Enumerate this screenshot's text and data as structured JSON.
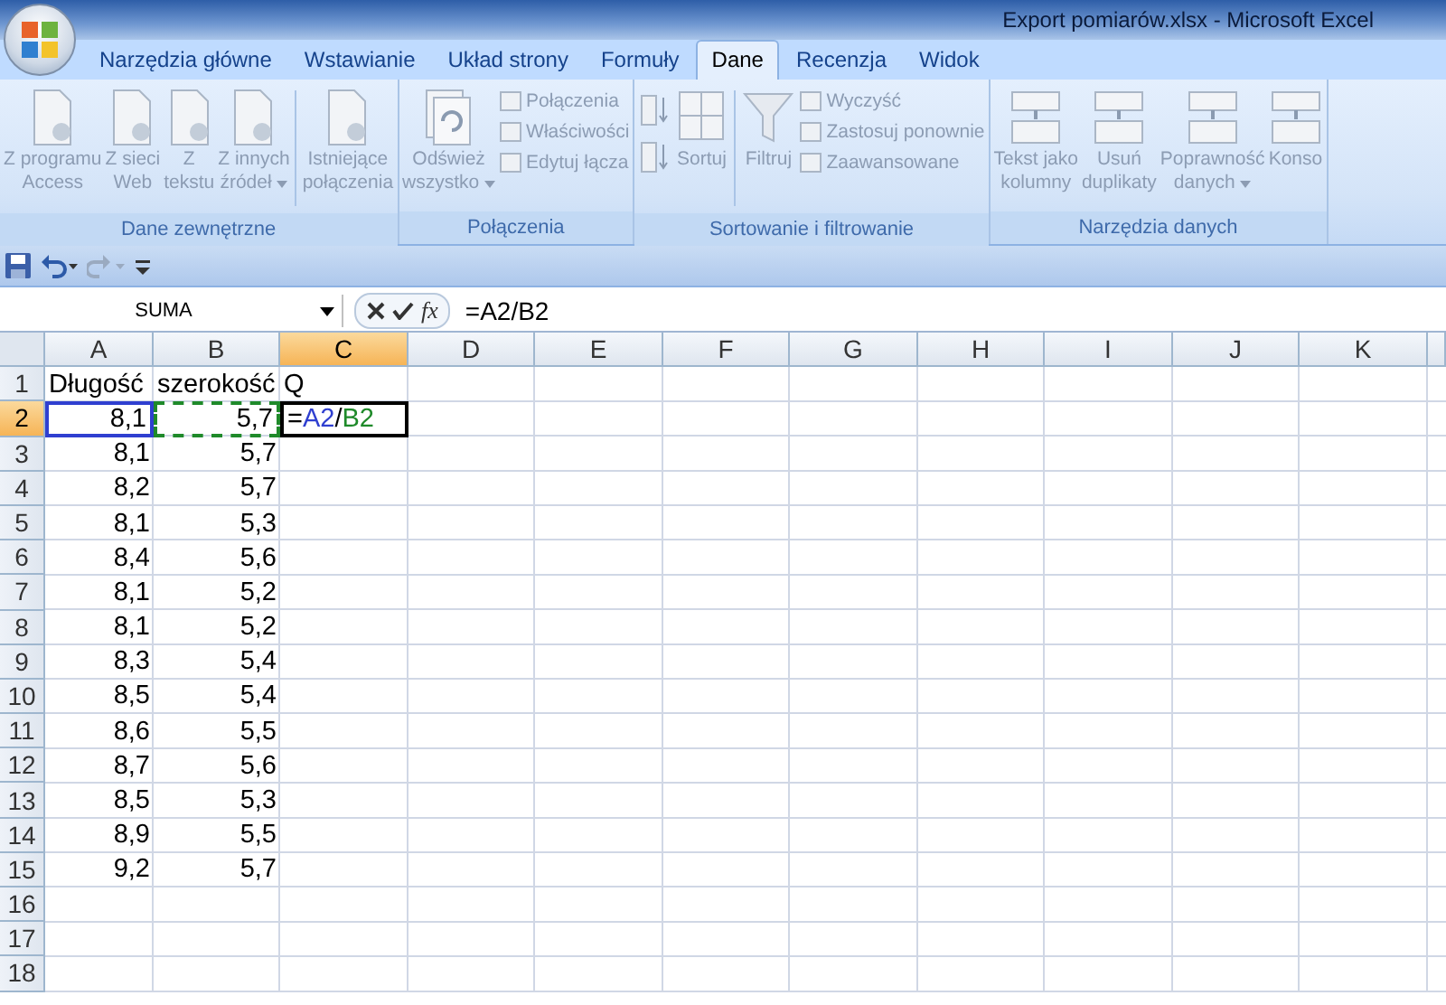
{
  "window": {
    "title": "Export pomiarów.xlsx - Microsoft Excel"
  },
  "tabs": [
    {
      "label": "Narzędzia główne",
      "selected": false
    },
    {
      "label": "Wstawianie",
      "selected": false
    },
    {
      "label": "Układ strony",
      "selected": false
    },
    {
      "label": "Formuły",
      "selected": false
    },
    {
      "label": "Dane",
      "selected": true
    },
    {
      "label": "Recenzja",
      "selected": false
    },
    {
      "label": "Widok",
      "selected": false
    }
  ],
  "ribbon": {
    "disabled": true,
    "groups": [
      {
        "label": "Dane zewnętrzne",
        "items": [
          {
            "kind": "large",
            "lines": [
              "Z programu",
              "Access"
            ],
            "dropdown": false
          },
          {
            "kind": "large",
            "lines": [
              "Z sieci",
              "Web"
            ],
            "dropdown": false
          },
          {
            "kind": "large",
            "lines": [
              "Z",
              "tekstu"
            ],
            "dropdown": false
          },
          {
            "kind": "large",
            "lines": [
              "Z innych",
              "źródeł"
            ],
            "dropdown": true
          },
          {
            "kind": "separator"
          },
          {
            "kind": "large",
            "lines": [
              "Istniejące",
              "połączenia"
            ],
            "dropdown": false
          }
        ]
      },
      {
        "label": "Połączenia",
        "items": [
          {
            "kind": "large",
            "lines": [
              "Odśwież",
              "wszystko"
            ],
            "dropdown": true
          },
          {
            "kind": "stack",
            "entries": [
              "Połączenia",
              "Właściwości",
              "Edytuj łącza"
            ]
          }
        ]
      },
      {
        "label": "Sortowanie i filtrowanie",
        "items": [
          {
            "kind": "sortpair"
          },
          {
            "kind": "large",
            "lines": [
              "Sortuj"
            ],
            "dropdown": false
          },
          {
            "kind": "separator"
          },
          {
            "kind": "large",
            "lines": [
              "Filtruj"
            ],
            "dropdown": false
          },
          {
            "kind": "stack",
            "entries": [
              "Wyczyść",
              "Zastosuj ponownie",
              "Zaawansowane"
            ]
          }
        ]
      },
      {
        "label": "Narzędzia danych",
        "items": [
          {
            "kind": "large",
            "lines": [
              "Tekst jako",
              "kolumny"
            ],
            "dropdown": false
          },
          {
            "kind": "large",
            "lines": [
              "Usuń",
              "duplikaty"
            ],
            "dropdown": false
          },
          {
            "kind": "large",
            "lines": [
              "Poprawność",
              "danych"
            ],
            "dropdown": true
          },
          {
            "kind": "large",
            "lines": [
              "Konso"
            ],
            "dropdown": false
          }
        ]
      }
    ]
  },
  "formula_bar": {
    "name_box": "SUMA",
    "function_label": "fx",
    "formula": "=A2/B2"
  },
  "columns": [
    {
      "label": "A",
      "selected": false
    },
    {
      "label": "B",
      "selected": false
    },
    {
      "label": "C",
      "selected": true
    },
    {
      "label": "D",
      "selected": false
    },
    {
      "label": "E",
      "selected": false
    },
    {
      "label": "F",
      "selected": false
    },
    {
      "label": "G",
      "selected": false
    },
    {
      "label": "H",
      "selected": false
    },
    {
      "label": "I",
      "selected": false
    },
    {
      "label": "J",
      "selected": false
    },
    {
      "label": "K",
      "selected": false
    }
  ],
  "rows": [
    {
      "number": "1",
      "selected": false,
      "cells": [
        "Długość",
        "szerokość",
        "Q"
      ]
    },
    {
      "number": "2",
      "selected": true,
      "cells": [
        {
          "kind": "reference",
          "text": "8,1",
          "color": "#2f3fd0"
        },
        {
          "kind": "marquee",
          "text": "5,7",
          "color": "#1f8a2a"
        },
        {
          "kind": "editing",
          "parts": [
            {
              "text": "=",
              "color": "#000000"
            },
            {
              "text": "A2",
              "color": "#2f3fd0"
            },
            {
              "text": "/",
              "color": "#000000"
            },
            {
              "text": "B2",
              "color": "#1f8a2a"
            }
          ]
        }
      ]
    },
    {
      "number": "3",
      "selected": false,
      "cells": [
        "8,1",
        "5,7"
      ]
    },
    {
      "number": "4",
      "selected": false,
      "cells": [
        "8,2",
        "5,7"
      ]
    },
    {
      "number": "5",
      "selected": false,
      "cells": [
        "8,1",
        "5,3"
      ]
    },
    {
      "number": "6",
      "selected": false,
      "cells": [
        "8,4",
        "5,6"
      ]
    },
    {
      "number": "7",
      "selected": false,
      "cells": [
        "8,1",
        "5,2"
      ]
    },
    {
      "number": "8",
      "selected": false,
      "cells": [
        "8,1",
        "5,2"
      ]
    },
    {
      "number": "9",
      "selected": false,
      "cells": [
        "8,3",
        "5,4"
      ]
    },
    {
      "number": "10",
      "selected": false,
      "cells": [
        "8,5",
        "5,4"
      ]
    },
    {
      "number": "11",
      "selected": false,
      "cells": [
        "8,6",
        "5,5"
      ]
    },
    {
      "number": "12",
      "selected": false,
      "cells": [
        "8,7",
        "5,6"
      ]
    },
    {
      "number": "13",
      "selected": false,
      "cells": [
        "8,5",
        "5,3"
      ]
    },
    {
      "number": "14",
      "selected": false,
      "cells": [
        "8,9",
        "5,5"
      ]
    },
    {
      "number": "15",
      "selected": false,
      "cells": [
        "9,2",
        "5,7"
      ]
    },
    {
      "number": "16",
      "selected": false,
      "cells": []
    },
    {
      "number": "17",
      "selected": false,
      "cells": []
    },
    {
      "number": "18",
      "selected": false,
      "cells": []
    }
  ]
}
